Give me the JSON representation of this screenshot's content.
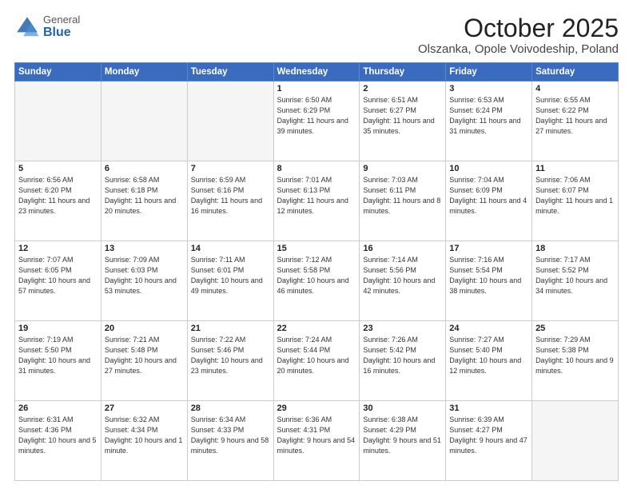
{
  "header": {
    "logo_general": "General",
    "logo_blue": "Blue",
    "title": "October 2025",
    "location": "Olszanka, Opole Voivodeship, Poland"
  },
  "days_of_week": [
    "Sunday",
    "Monday",
    "Tuesday",
    "Wednesday",
    "Thursday",
    "Friday",
    "Saturday"
  ],
  "weeks": [
    [
      {
        "day": "",
        "info": ""
      },
      {
        "day": "",
        "info": ""
      },
      {
        "day": "",
        "info": ""
      },
      {
        "day": "1",
        "info": "Sunrise: 6:50 AM\nSunset: 6:29 PM\nDaylight: 11 hours\nand 39 minutes."
      },
      {
        "day": "2",
        "info": "Sunrise: 6:51 AM\nSunset: 6:27 PM\nDaylight: 11 hours\nand 35 minutes."
      },
      {
        "day": "3",
        "info": "Sunrise: 6:53 AM\nSunset: 6:24 PM\nDaylight: 11 hours\nand 31 minutes."
      },
      {
        "day": "4",
        "info": "Sunrise: 6:55 AM\nSunset: 6:22 PM\nDaylight: 11 hours\nand 27 minutes."
      }
    ],
    [
      {
        "day": "5",
        "info": "Sunrise: 6:56 AM\nSunset: 6:20 PM\nDaylight: 11 hours\nand 23 minutes."
      },
      {
        "day": "6",
        "info": "Sunrise: 6:58 AM\nSunset: 6:18 PM\nDaylight: 11 hours\nand 20 minutes."
      },
      {
        "day": "7",
        "info": "Sunrise: 6:59 AM\nSunset: 6:16 PM\nDaylight: 11 hours\nand 16 minutes."
      },
      {
        "day": "8",
        "info": "Sunrise: 7:01 AM\nSunset: 6:13 PM\nDaylight: 11 hours\nand 12 minutes."
      },
      {
        "day": "9",
        "info": "Sunrise: 7:03 AM\nSunset: 6:11 PM\nDaylight: 11 hours\nand 8 minutes."
      },
      {
        "day": "10",
        "info": "Sunrise: 7:04 AM\nSunset: 6:09 PM\nDaylight: 11 hours\nand 4 minutes."
      },
      {
        "day": "11",
        "info": "Sunrise: 7:06 AM\nSunset: 6:07 PM\nDaylight: 11 hours\nand 1 minute."
      }
    ],
    [
      {
        "day": "12",
        "info": "Sunrise: 7:07 AM\nSunset: 6:05 PM\nDaylight: 10 hours\nand 57 minutes."
      },
      {
        "day": "13",
        "info": "Sunrise: 7:09 AM\nSunset: 6:03 PM\nDaylight: 10 hours\nand 53 minutes."
      },
      {
        "day": "14",
        "info": "Sunrise: 7:11 AM\nSunset: 6:01 PM\nDaylight: 10 hours\nand 49 minutes."
      },
      {
        "day": "15",
        "info": "Sunrise: 7:12 AM\nSunset: 5:58 PM\nDaylight: 10 hours\nand 46 minutes."
      },
      {
        "day": "16",
        "info": "Sunrise: 7:14 AM\nSunset: 5:56 PM\nDaylight: 10 hours\nand 42 minutes."
      },
      {
        "day": "17",
        "info": "Sunrise: 7:16 AM\nSunset: 5:54 PM\nDaylight: 10 hours\nand 38 minutes."
      },
      {
        "day": "18",
        "info": "Sunrise: 7:17 AM\nSunset: 5:52 PM\nDaylight: 10 hours\nand 34 minutes."
      }
    ],
    [
      {
        "day": "19",
        "info": "Sunrise: 7:19 AM\nSunset: 5:50 PM\nDaylight: 10 hours\nand 31 minutes."
      },
      {
        "day": "20",
        "info": "Sunrise: 7:21 AM\nSunset: 5:48 PM\nDaylight: 10 hours\nand 27 minutes."
      },
      {
        "day": "21",
        "info": "Sunrise: 7:22 AM\nSunset: 5:46 PM\nDaylight: 10 hours\nand 23 minutes."
      },
      {
        "day": "22",
        "info": "Sunrise: 7:24 AM\nSunset: 5:44 PM\nDaylight: 10 hours\nand 20 minutes."
      },
      {
        "day": "23",
        "info": "Sunrise: 7:26 AM\nSunset: 5:42 PM\nDaylight: 10 hours\nand 16 minutes."
      },
      {
        "day": "24",
        "info": "Sunrise: 7:27 AM\nSunset: 5:40 PM\nDaylight: 10 hours\nand 12 minutes."
      },
      {
        "day": "25",
        "info": "Sunrise: 7:29 AM\nSunset: 5:38 PM\nDaylight: 10 hours\nand 9 minutes."
      }
    ],
    [
      {
        "day": "26",
        "info": "Sunrise: 6:31 AM\nSunset: 4:36 PM\nDaylight: 10 hours\nand 5 minutes."
      },
      {
        "day": "27",
        "info": "Sunrise: 6:32 AM\nSunset: 4:34 PM\nDaylight: 10 hours\nand 1 minute."
      },
      {
        "day": "28",
        "info": "Sunrise: 6:34 AM\nSunset: 4:33 PM\nDaylight: 9 hours\nand 58 minutes."
      },
      {
        "day": "29",
        "info": "Sunrise: 6:36 AM\nSunset: 4:31 PM\nDaylight: 9 hours\nand 54 minutes."
      },
      {
        "day": "30",
        "info": "Sunrise: 6:38 AM\nSunset: 4:29 PM\nDaylight: 9 hours\nand 51 minutes."
      },
      {
        "day": "31",
        "info": "Sunrise: 6:39 AM\nSunset: 4:27 PM\nDaylight: 9 hours\nand 47 minutes."
      },
      {
        "day": "",
        "info": ""
      }
    ]
  ]
}
